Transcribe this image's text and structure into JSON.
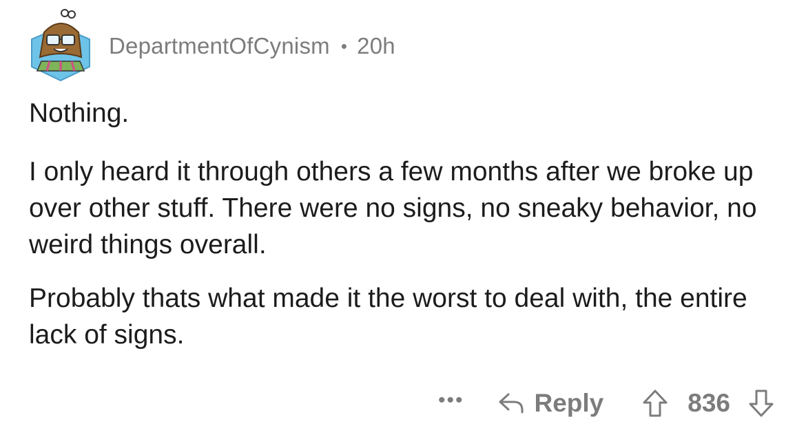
{
  "comment": {
    "username": "DepartmentOfCynism",
    "separator": "•",
    "time": "20h",
    "paragraphs": [
      "Nothing.",
      "I only heard it through others a few months after we broke up over other stuff. There were no signs, no sneaky behavior, no weird things overall.",
      "Probably thats what made it the worst to deal with, the entire lack of signs."
    ],
    "actions": {
      "more_label": "•••",
      "reply_label": "Reply",
      "score": "836"
    }
  },
  "colors": {
    "text": "#1c1c1c",
    "meta": "#7c7c7c",
    "avatar_bg": "#6ec3e8"
  },
  "icons": {
    "avatar": "user-avatar",
    "reply": "reply-arrow-icon",
    "upvote": "upvote-arrow-icon",
    "downvote": "downvote-arrow-icon"
  }
}
